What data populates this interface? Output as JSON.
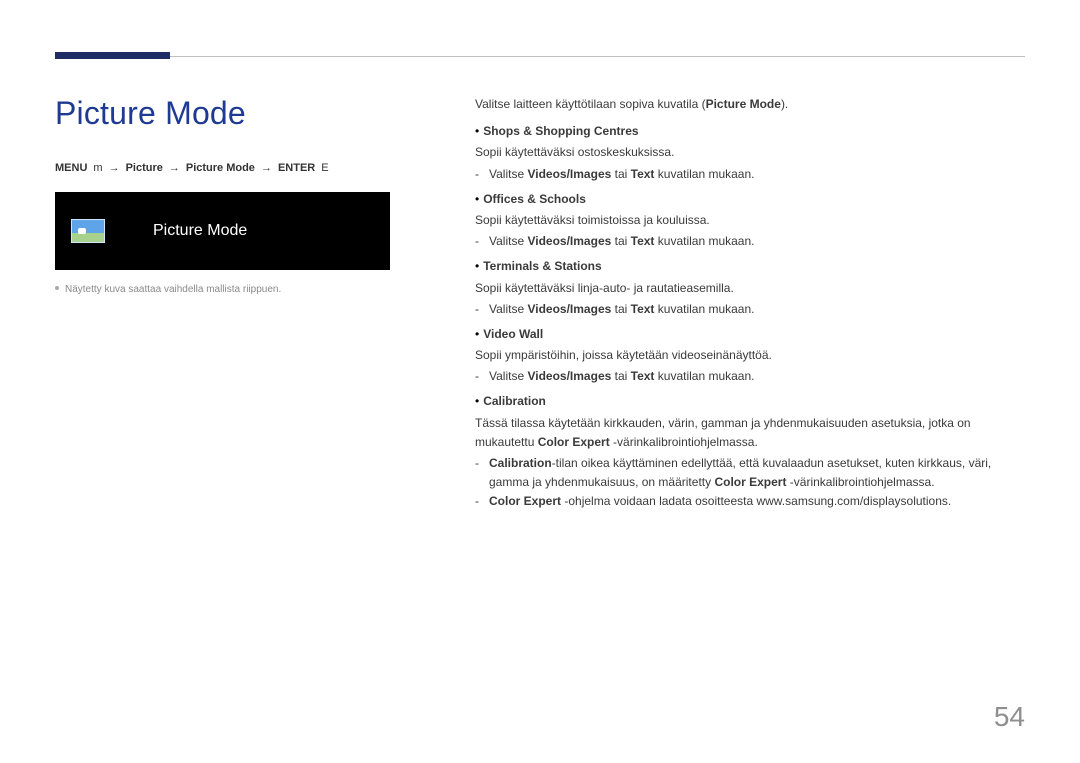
{
  "header": {
    "title": "Picture Mode"
  },
  "path": {
    "p1": "MENU",
    "m": "m",
    "p2": "Picture",
    "arrow1": "→",
    "p3": "Picture Mode",
    "arrow2": "→",
    "p4": "ENTER",
    "e": "E"
  },
  "preview": {
    "label": "Picture Mode"
  },
  "note": "Näytetty kuva saattaa vaihdella mallista riippuen.",
  "right": {
    "intro_a": "Valitse laitteen käyttötilaan sopiva kuvatila (",
    "intro_b": "Picture Mode",
    "intro_c": ").",
    "items": [
      {
        "head_bullet": "•",
        "head_a": "Shops & Shopping Centres",
        "desc": "Sopii käytettäväksi ostoskeskuksissa.",
        "sub_a": "Valitse ",
        "sub_b": "Videos/Images",
        "sub_c": " tai ",
        "sub_d": "Text",
        "sub_e": " kuvatilan mukaan."
      },
      {
        "head_bullet": "•",
        "head_a": "Offices & Schools",
        "desc": "Sopii käytettäväksi toimistoissa ja kouluissa.",
        "sub_a": "Valitse ",
        "sub_b": "Videos/Images",
        "sub_c": " tai ",
        "sub_d": "Text",
        "sub_e": " kuvatilan mukaan."
      },
      {
        "head_bullet": "•",
        "head_a": "Terminals & Stations",
        "desc": "Sopii käytettäväksi linja-auto- ja rautatieasemilla.",
        "sub_a": "Valitse ",
        "sub_b": "Videos/Images",
        "sub_c": " tai ",
        "sub_d": "Text",
        "sub_e": " kuvatilan mukaan."
      },
      {
        "head_bullet": "•",
        "head_a": "Video Wall",
        "desc": "Sopii ympäristöihin, joissa käytetään videoseinänäyttöä.",
        "sub_a": "Valitse ",
        "sub_b": "Videos/Images",
        "sub_c": " tai ",
        "sub_d": "Text",
        "sub_e": " kuvatilan mukaan."
      }
    ],
    "calib": {
      "head_bullet": "•",
      "head_a": "Calibration",
      "desc_a": "Tässä tilassa käytetään kirkkauden, värin, gamman ja yhdenmukaisuuden asetuksia, jotka on mukautettu ",
      "desc_b": "Color Expert",
      "desc_c": " -värinkalibrointiohjelmassa.",
      "sub1_a": "Calibration",
      "sub1_b": "-tilan oikea käyttäminen edellyttää, että kuvalaadun asetukset, kuten kirkkaus, väri, gamma ja yhdenmukaisuus, on määritetty ",
      "sub1_c": "Color Expert",
      "sub1_d": " -värinkalibrointiohjelmassa.",
      "sub2_a": "Color Expert",
      "sub2_b": " -ohjelma voidaan ladata osoitteesta www.samsung.com/displaysolutions."
    }
  },
  "pagenum": "54"
}
